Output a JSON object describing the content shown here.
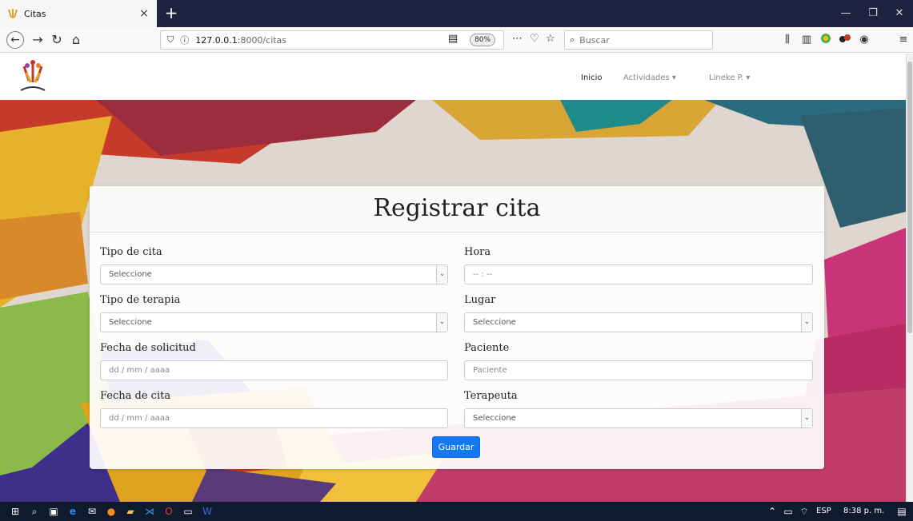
{
  "browser": {
    "tab_title": "Citas",
    "tab_close": "×",
    "new_tab": "+",
    "url_host": "127.0.0.1",
    "url_path": ":8000/citas",
    "zoom": "80%",
    "search_placeholder": "Buscar",
    "window_controls": [
      "—",
      "❐",
      "✕"
    ]
  },
  "site_nav": {
    "items": [
      {
        "label": "Inicio"
      },
      {
        "label": "Actividades ▾"
      },
      {
        "label": "Lineke P. ▾"
      }
    ]
  },
  "form": {
    "title": "Registrar cita",
    "fields": {
      "tipo_cita": {
        "label": "Tipo de cita",
        "value": "Seleccione"
      },
      "hora": {
        "label": "Hora",
        "value": "-- : --"
      },
      "tipo_terapia": {
        "label": "Tipo de terapia",
        "value": "Seleccione"
      },
      "lugar": {
        "label": "Lugar",
        "value": "Seleccione"
      },
      "fecha_solicitud": {
        "label": "Fecha de solicitud",
        "value": "dd / mm / aaaa"
      },
      "paciente": {
        "label": "Paciente",
        "placeholder": "Paciente"
      },
      "fecha_cita": {
        "label": "Fecha de cita",
        "value": "dd / mm / aaaa"
      },
      "terapeuta": {
        "label": "Terapeuta",
        "value": "Seleccione"
      }
    },
    "submit_label": "Guardar"
  },
  "taskbar": {
    "language": "ESP",
    "time": "8:38 p. m."
  },
  "colors": {
    "primary": "#1479f0",
    "tabbar": "#202340",
    "taskbar": "#0f1a2e"
  }
}
